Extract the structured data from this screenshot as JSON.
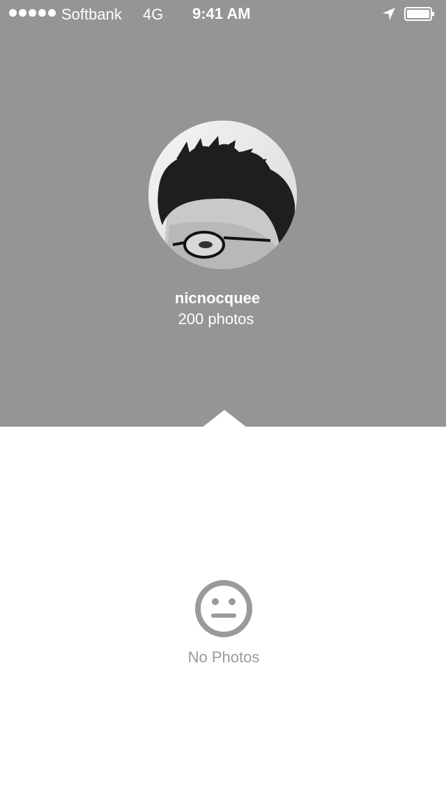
{
  "status_bar": {
    "carrier": "Softbank",
    "network": "4G",
    "time": "9:41 AM",
    "icons": [
      "signal-dots",
      "location-arrow-icon",
      "battery-icon"
    ]
  },
  "profile": {
    "username": "nicnocquee",
    "photo_count": "200 photos"
  },
  "empty_state": {
    "icon": "neutral-face-icon",
    "label": "No Photos"
  },
  "colors": {
    "header_background": "#959595",
    "content_background": "#ffffff",
    "empty_state_gray": "#9a9a9a"
  }
}
